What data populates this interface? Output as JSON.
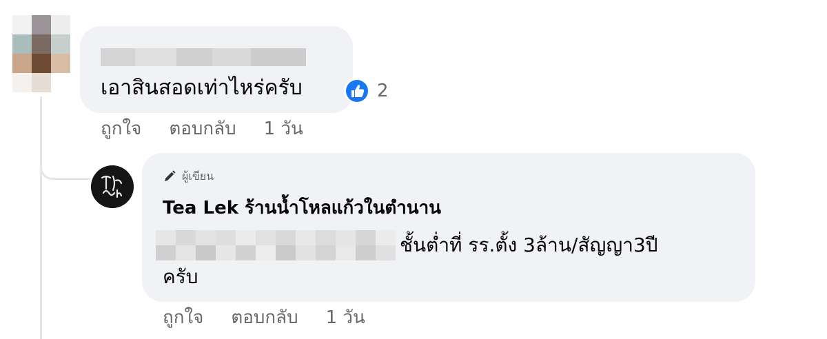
{
  "comment": {
    "text": "เอาสินสอดเท่าไหร่ครับ",
    "reaction_icon": "like-thumb-icon",
    "reaction_count": "2",
    "actions": {
      "like": "ถูกใจ",
      "reply": "ตอบกลับ",
      "time": "1 วัน"
    }
  },
  "reply": {
    "author_badge": "ผู้เขียน",
    "author_name": "Tea Lek ร้านน้ำโหลแก้วในตำนาน",
    "text_line_1": "ชั้นต่ำที่ รร.ตั้ง 3ล้าน/สัญญา3ปี",
    "text_line_2": "ครับ",
    "actions": {
      "like": "ถูกใจ",
      "reply": "ตอบกลับ",
      "time": "1 วัน"
    }
  },
  "colors": {
    "bubble": "#f0f2f5",
    "secondary_text": "#65676b",
    "like_blue": "#1877f2",
    "thread_line": "#e4e6eb"
  }
}
